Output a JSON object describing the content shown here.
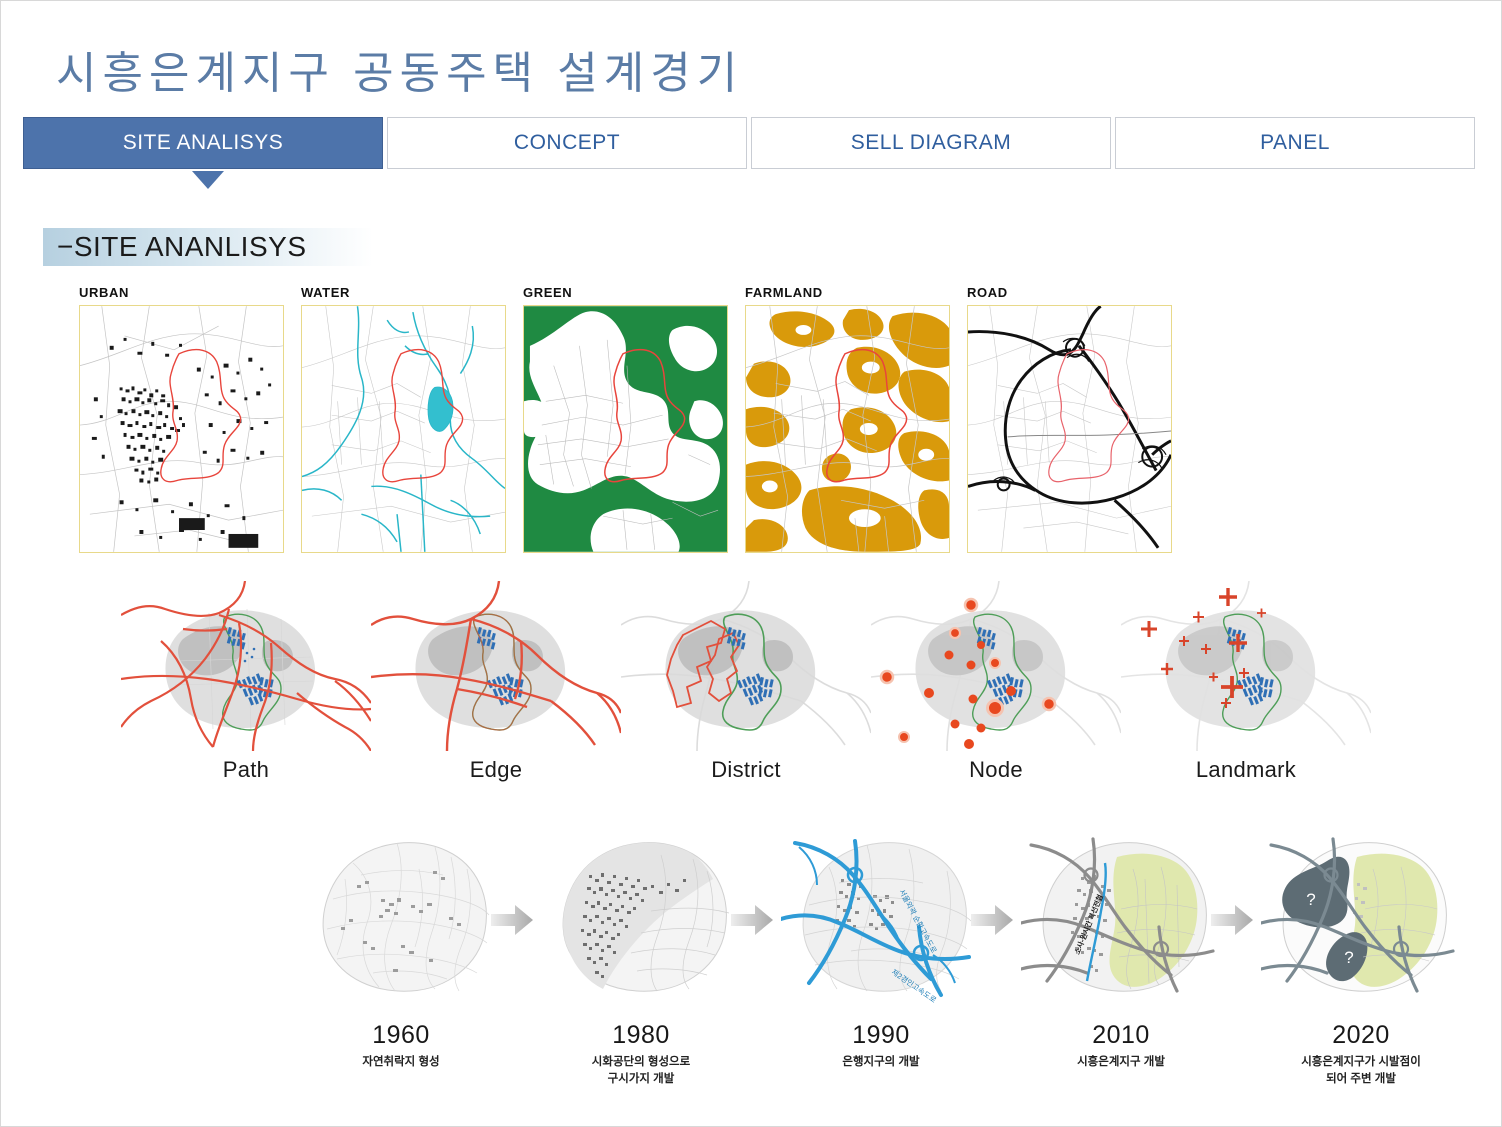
{
  "slide": {
    "title": "시흥은계지구 공동주택 설계경기",
    "title_color": "#5b7ca6",
    "background": "#ffffff"
  },
  "tabs": {
    "active_index": 0,
    "active_bg": "#4d73ab",
    "items": [
      {
        "label": "SITE ANALISYS"
      },
      {
        "label": "CONCEPT"
      },
      {
        "label": "SELL DIAGRAM"
      },
      {
        "label": "PANEL"
      }
    ]
  },
  "section": {
    "heading": "−SITE ANANLISYS"
  },
  "thematic_maps": [
    {
      "label": "URBAN",
      "theme_color": "#111111",
      "frame_color": "#e8d98a"
    },
    {
      "label": "WATER",
      "theme_color": "#29b6c8",
      "frame_color": "#e8d98a"
    },
    {
      "label": "GREEN",
      "theme_color": "#1f8a42",
      "frame_color": "#e8d98a"
    },
    {
      "label": "FARMLAND",
      "theme_color": "#d99a0b",
      "frame_color": "#e8d98a"
    },
    {
      "label": "ROAD",
      "theme_color": "#000000",
      "frame_color": "#e8d98a"
    }
  ],
  "lynch_diagrams": [
    {
      "label": "Path",
      "accent_color": "#e2503c"
    },
    {
      "label": "Edge",
      "accent_color": "#e2503c"
    },
    {
      "label": "District",
      "accent_color": "#e2503c"
    },
    {
      "label": "Node",
      "accent_color": "#e8481f"
    },
    {
      "label": "Landmark",
      "accent_color": "#e04a2a"
    }
  ],
  "timeline": {
    "arrow_color": "#c6c6c6",
    "items": [
      {
        "year": "1960",
        "caption": "자연취락지 형성"
      },
      {
        "year": "1980",
        "caption": "시화공단의 형성으로\n구시가지 개발"
      },
      {
        "year": "1990",
        "caption": "은행지구의 개발"
      },
      {
        "year": "2010",
        "caption": "시흥은계지구 개발"
      },
      {
        "year": "2020",
        "caption": "시흥은계지구가 시발점이\n되어 주변 개발"
      }
    ],
    "map_annotations": {
      "y1990_highway_1": "서울외곽 순환고속도로",
      "y1990_highway_2": "제2경인고속도로",
      "y2010_railway": "소사-원시간 복선전철",
      "y2020_question_mark": "?"
    }
  }
}
